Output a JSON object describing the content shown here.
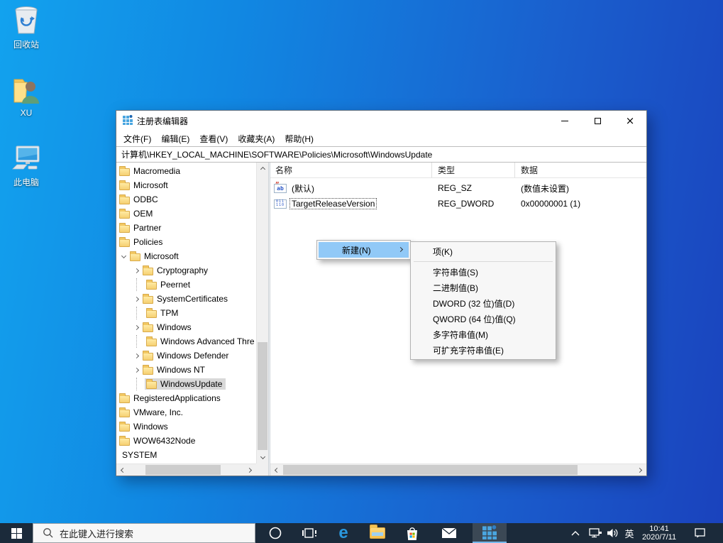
{
  "colors": {
    "desktop_gradient_left": "#12a2ee",
    "desktop_gradient_right": "#1a42bd",
    "taskbar_background": "#1b2a3a",
    "menu_highlight": "#91c9f7",
    "tree_selection": "#d9d9d9",
    "folder_icon": "#f6d072",
    "active_app_underline": "#76b9ed"
  },
  "desktop": {
    "icons": [
      {
        "label": "回收站",
        "icon": "recycle-bin-icon"
      },
      {
        "label": "XU",
        "icon": "user-folder-icon"
      },
      {
        "label": "此电脑",
        "icon": "this-pc-icon"
      }
    ]
  },
  "window": {
    "title": "注册表编辑器",
    "app_icon": "registry-editor-icon",
    "controls": [
      "minimize",
      "maximize",
      "close"
    ],
    "menu": [
      "文件(F)",
      "编辑(E)",
      "查看(V)",
      "收藏夹(A)",
      "帮助(H)"
    ],
    "address": "计算机\\HKEY_LOCAL_MACHINE\\SOFTWARE\\Policies\\Microsoft\\WindowsUpdate",
    "tree": {
      "items": [
        {
          "label": "Macromedia",
          "level": 1,
          "exp": "none"
        },
        {
          "label": "Microsoft",
          "level": 1,
          "exp": "none"
        },
        {
          "label": "ODBC",
          "level": 1,
          "exp": "none"
        },
        {
          "label": "OEM",
          "level": 1,
          "exp": "none"
        },
        {
          "label": "Partner",
          "level": 1,
          "exp": "none"
        },
        {
          "label": "Policies",
          "level": 1,
          "exp": "none"
        },
        {
          "label": "Microsoft",
          "level": 2,
          "exp": "expanded"
        },
        {
          "label": "Cryptography",
          "level": 3,
          "exp": "collapsed"
        },
        {
          "label": "Peernet",
          "level": 3,
          "exp": "line"
        },
        {
          "label": "SystemCertificates",
          "level": 3,
          "exp": "collapsed"
        },
        {
          "label": "TPM",
          "level": 3,
          "exp": "line"
        },
        {
          "label": "Windows",
          "level": 3,
          "exp": "collapsed"
        },
        {
          "label": "Windows Advanced Thre",
          "level": 3,
          "exp": "line"
        },
        {
          "label": "Windows Defender",
          "level": 3,
          "exp": "collapsed"
        },
        {
          "label": "Windows NT",
          "level": 3,
          "exp": "collapsed"
        },
        {
          "label": "WindowsUpdate",
          "level": 3,
          "exp": "line",
          "selected": true
        },
        {
          "label": "RegisteredApplications",
          "level": 1,
          "exp": "none"
        },
        {
          "label": "VMware, Inc.",
          "level": 1,
          "exp": "none"
        },
        {
          "label": "Windows",
          "level": 1,
          "exp": "none"
        },
        {
          "label": "WOW6432Node",
          "level": 1,
          "exp": "none"
        },
        {
          "label": "SYSTEM",
          "level": 0,
          "exp": "none",
          "noicon": true
        }
      ]
    },
    "values": {
      "columns": [
        "名称",
        "类型",
        "数据"
      ],
      "rows": [
        {
          "icon": "string",
          "name": "(默认)",
          "type": "REG_SZ",
          "data": "(数值未设置)",
          "focused": false
        },
        {
          "icon": "dword",
          "name": "TargetReleaseVersion",
          "type": "REG_DWORD",
          "data": "0x00000001 (1)",
          "focused": true
        }
      ]
    }
  },
  "context_menu": {
    "parent": {
      "label": "新建(N)",
      "has_submenu": true
    },
    "submenu": {
      "items": [
        {
          "label": "项(K)"
        },
        {
          "separator": true
        },
        {
          "label": "字符串值(S)"
        },
        {
          "label": "二进制值(B)"
        },
        {
          "label": "DWORD (32 位)值(D)"
        },
        {
          "label": "QWORD (64 位)值(Q)"
        },
        {
          "label": "多字符串值(M)"
        },
        {
          "label": "可扩充字符串值(E)"
        }
      ]
    }
  },
  "taskbar": {
    "search_placeholder": "在此键入进行搜索",
    "app_icons": [
      "start",
      "cortana",
      "task-view",
      "edge",
      "file-explorer",
      "store",
      "mail",
      "registry-editor"
    ],
    "active_app": "registry-editor",
    "tray": {
      "icons": [
        "chevron-up",
        "network",
        "volume",
        "action-center"
      ],
      "ime": "英",
      "time": "10:41",
      "date": "2020/7/11"
    }
  }
}
